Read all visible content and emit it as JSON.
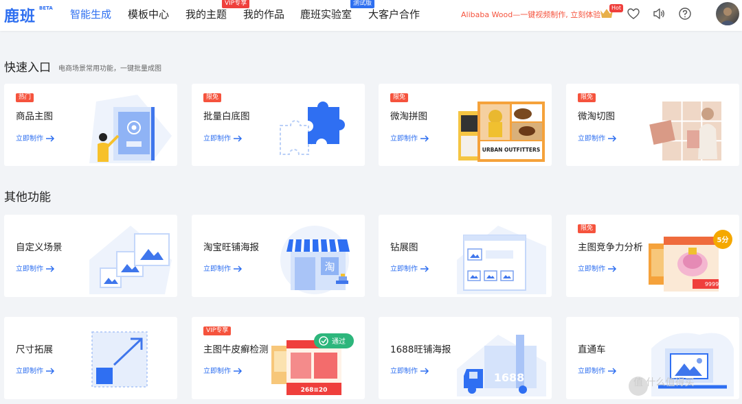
{
  "header": {
    "logo": "鹿班",
    "logo_beta": "BETA",
    "nav": [
      {
        "label": "智能生成",
        "active": true
      },
      {
        "label": "模板中心",
        "active": false
      },
      {
        "label": "我的主题",
        "active": false,
        "badge": "VIP专享"
      },
      {
        "label": "我的作品",
        "active": false
      },
      {
        "label": "鹿班实验室",
        "active": false,
        "badge": "测试版"
      },
      {
        "label": "大客户合作",
        "active": false
      }
    ],
    "promo": "Alibaba Wood—一键视频制作, 立刻体验",
    "hot_badge": "Hot"
  },
  "quick": {
    "title": "快速入口",
    "subtitle": "电商场景常用功能，一键批量成图",
    "cards": [
      {
        "badge": "热门",
        "title": "商品主图",
        "action": "立即制作"
      },
      {
        "badge": "限免",
        "title": "批量白底图",
        "action": "立即制作"
      },
      {
        "badge": "限免",
        "title": "微淘拼图",
        "action": "立即制作",
        "illus_text": "URBAN OUTFITTERS"
      },
      {
        "badge": "限免",
        "title": "微淘切图",
        "action": "立即制作"
      }
    ]
  },
  "other": {
    "title": "其他功能",
    "cards": [
      {
        "title": "自定义场景",
        "action": "立即制作"
      },
      {
        "title": "淘宝旺铺海报",
        "action": "立即制作",
        "illus_text": "淘"
      },
      {
        "title": "钻展图",
        "action": "立即制作"
      },
      {
        "badge": "限免",
        "title": "主图竞争力分析",
        "action": "立即制作",
        "illus_text": "5分",
        "illus_price": "9999"
      },
      {
        "title": "尺寸拓展",
        "action": "立即制作"
      },
      {
        "badge": "VIP专享",
        "title": "主图牛皮癣检测",
        "action": "立即制作",
        "illus_text": "通过",
        "illus_price": "268≡20"
      },
      {
        "title": "1688旺铺海报",
        "action": "立即制作",
        "illus_text": "1688"
      },
      {
        "title": "直通车",
        "action": "立即制作"
      }
    ]
  },
  "watermark": "值 什么值得买",
  "colors": {
    "brand": "#2e6ff0",
    "badge": "#f5533d",
    "promo": "#f5533d"
  }
}
